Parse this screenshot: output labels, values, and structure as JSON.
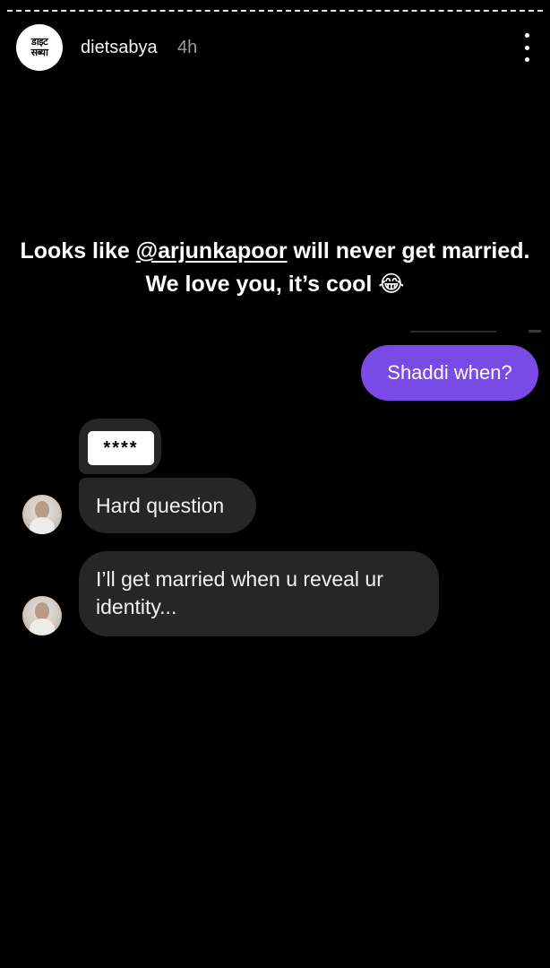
{
  "story": {
    "username": "dietsabya",
    "timestamp": "4h",
    "logo_text_line1": "डाइट",
    "logo_text_line2": "सब्या"
  },
  "caption": {
    "text_before": "Looks like ",
    "mention": "@arjunkapoor",
    "text_after": " will never get married. We love you, it’s cool ",
    "emoji": "😂"
  },
  "messages": {
    "sent_1": "Shaddi when?",
    "sticker": "****",
    "received_1": "Hard question",
    "received_2": "I’ll get married when u reveal ur identity..."
  },
  "icons": {
    "more": "more-vertical-icon",
    "emoji": "laughing-tears-emoji",
    "avatar": "sender-avatar-icon"
  },
  "colors": {
    "background": "#000000",
    "sent_bubble": "#7a4ae6",
    "received_bubble": "#262626",
    "timestamp": "#9a9a9a"
  }
}
